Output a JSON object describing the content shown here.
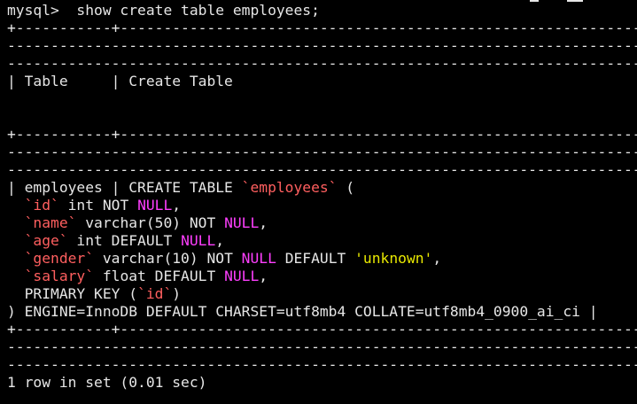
{
  "terminal": {
    "colors": {
      "background": "#000000",
      "text": "#e6e6e6",
      "identifier": "#ff5f5f",
      "keyword_null": "#ff3fff",
      "string_literal": "#e8e800"
    },
    "lines": [
      [
        {
          "t": "mysql>  show create table employees;",
          "c": "plain"
        }
      ],
      [
        {
          "t": "+-----------+-------------------------------------------------------------------------------",
          "c": "plain"
        }
      ],
      [
        {
          "t": "---------------------------------------------------------------------------------------------",
          "c": "plain"
        }
      ],
      [
        {
          "t": "---------------------------------------------------------------------------------------------",
          "c": "plain"
        }
      ],
      [
        {
          "t": "| Table     | Create Table",
          "c": "plain"
        }
      ],
      [
        {
          "t": "",
          "c": "plain"
        }
      ],
      [
        {
          "t": "",
          "c": "plain"
        }
      ],
      [
        {
          "t": "+-----------+-------------------------------------------------------------------------------",
          "c": "plain"
        }
      ],
      [
        {
          "t": "---------------------------------------------------------------------------------------------",
          "c": "plain"
        }
      ],
      [
        {
          "t": "---------------------------------------------------------------------------------------------",
          "c": "plain"
        }
      ],
      [
        {
          "t": "| employees | CREATE TABLE ",
          "c": "plain"
        },
        {
          "t": "`employees`",
          "c": "backtick"
        },
        {
          "t": " (",
          "c": "plain"
        }
      ],
      [
        {
          "t": "  ",
          "c": "plain"
        },
        {
          "t": "`id`",
          "c": "backtick"
        },
        {
          "t": " int NOT ",
          "c": "plain"
        },
        {
          "t": "NULL",
          "c": "null"
        },
        {
          "t": ",",
          "c": "plain"
        }
      ],
      [
        {
          "t": "  ",
          "c": "plain"
        },
        {
          "t": "`name`",
          "c": "backtick"
        },
        {
          "t": " varchar(50) NOT ",
          "c": "plain"
        },
        {
          "t": "NULL",
          "c": "null"
        },
        {
          "t": ",",
          "c": "plain"
        }
      ],
      [
        {
          "t": "  ",
          "c": "plain"
        },
        {
          "t": "`age`",
          "c": "backtick"
        },
        {
          "t": " int DEFAULT ",
          "c": "plain"
        },
        {
          "t": "NULL",
          "c": "null"
        },
        {
          "t": ",",
          "c": "plain"
        }
      ],
      [
        {
          "t": "  ",
          "c": "plain"
        },
        {
          "t": "`gender`",
          "c": "backtick"
        },
        {
          "t": " varchar(10) NOT ",
          "c": "plain"
        },
        {
          "t": "NULL",
          "c": "null"
        },
        {
          "t": " DEFAULT ",
          "c": "plain"
        },
        {
          "t": "'unknown'",
          "c": "string"
        },
        {
          "t": ",",
          "c": "plain"
        }
      ],
      [
        {
          "t": "  ",
          "c": "plain"
        },
        {
          "t": "`salary`",
          "c": "backtick"
        },
        {
          "t": " float DEFAULT ",
          "c": "plain"
        },
        {
          "t": "NULL",
          "c": "null"
        },
        {
          "t": ",",
          "c": "plain"
        }
      ],
      [
        {
          "t": "  PRIMARY KEY (",
          "c": "plain"
        },
        {
          "t": "`id`",
          "c": "backtick"
        },
        {
          "t": ")",
          "c": "plain"
        }
      ],
      [
        {
          "t": ") ENGINE=InnoDB DEFAULT CHARSET=utf8mb4 COLLATE=utf8mb4_0900_ai_ci |",
          "c": "plain"
        }
      ],
      [
        {
          "t": "+-----------+-------------------------------------------------------------------------------",
          "c": "plain"
        }
      ],
      [
        {
          "t": "---------------------------------------------------------------------------------------------",
          "c": "plain"
        }
      ],
      [
        {
          "t": "---------------------------------------------------------------------------------------------",
          "c": "plain"
        }
      ],
      [
        {
          "t": "1 row in set (0.01 sec)",
          "c": "plain"
        }
      ],
      [
        {
          "t": "",
          "c": "plain"
        }
      ]
    ]
  }
}
